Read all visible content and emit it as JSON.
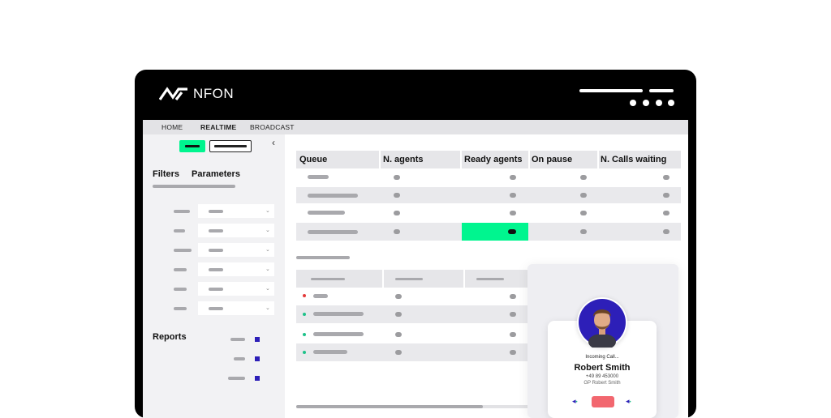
{
  "brand": {
    "name": "NFON"
  },
  "nav": {
    "items": [
      "HOME",
      "REALTIME",
      "BROADCAST"
    ],
    "active": "REALTIME"
  },
  "sidebar": {
    "collapse_icon": "chevron-left-icon",
    "tabs": [
      "Filters",
      "Parameters"
    ],
    "reports_label": "Reports"
  },
  "queue_table": {
    "headers": [
      "Queue",
      "N. agents",
      "Ready agents",
      "On pause",
      "N. Calls waiting"
    ],
    "highlight_color": "#00f58f"
  },
  "incoming_call": {
    "status": "Incoming Call...",
    "name": "Robert Smith",
    "phone": "+49 89 453000",
    "subtitle": "GP Robert Smith"
  },
  "colors": {
    "accent": "#00f58f",
    "brand_blue": "#2d1fb8",
    "decline": "#f2676f",
    "status_red": "#e33b3b",
    "status_green": "#1fc28a"
  }
}
